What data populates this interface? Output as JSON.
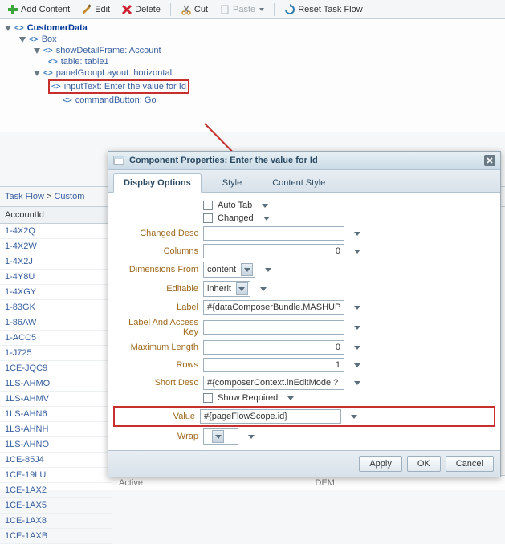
{
  "toolbar": {
    "add_label": "Add Content",
    "edit_label": "Edit",
    "delete_label": "Delete",
    "cut_label": "Cut",
    "paste_label": "Paste",
    "reset_label": "Reset Task Flow"
  },
  "tree": {
    "root": "CustomerData",
    "box": "Box",
    "showDetail": "showDetailFrame: Account",
    "table": "table: table1",
    "pgl": "panelGroupLayout: horizontal",
    "inputText": "inputText: Enter the value for Id",
    "cmdButton": "commandButton: Go"
  },
  "breadcrumb": {
    "task_flow": "Task Flow",
    "current": "Custom"
  },
  "grid": {
    "header": "AccountId",
    "rows": [
      "1-4X2Q",
      "1-4X2W",
      "1-4X2J",
      "1-4Y8U",
      "1-4XGY",
      "1-83GK",
      "1-86AW",
      "1-ACC5",
      "1-J725",
      "1CE-JQC9",
      "1LS-AHMO",
      "1LS-AHMV",
      "1LS-AHN6",
      "1LS-AHNH",
      "1LS-AHNO",
      "1CE-85J4",
      "1CE-19LU",
      "1CE-1AX2",
      "1CE-1AX5",
      "1CE-1AX8",
      "1CE-1AXB"
    ],
    "footer_cols": [
      "Active",
      "DEM"
    ]
  },
  "dialog": {
    "title": "Component Properties: Enter the value for Id",
    "tabs": {
      "display": "Display Options",
      "style": "Style",
      "content_style": "Content Style"
    },
    "checkboxes": {
      "auto_tab": "Auto Tab",
      "changed": "Changed",
      "show_required": "Show Required"
    },
    "labels": {
      "changed_desc": "Changed Desc",
      "columns": "Columns",
      "dimensions_from": "Dimensions From",
      "editable": "Editable",
      "label": "Label",
      "label_access": "Label And Access Key",
      "max_length": "Maximum Length",
      "rows": "Rows",
      "short_desc": "Short Desc",
      "value": "Value",
      "wrap": "Wrap"
    },
    "values": {
      "changed_desc": "",
      "columns": "0",
      "dimensions_from": "content",
      "editable": "inherit",
      "label": "#{dataComposerBundle.MASHUP_S",
      "label_access": "",
      "max_length": "0",
      "rows": "1",
      "short_desc": "#{composerContext.inEditMode ? c",
      "value": "#{pageFlowScope.id}",
      "wrap": ""
    },
    "buttons": {
      "apply": "Apply",
      "ok": "OK",
      "cancel": "Cancel"
    }
  }
}
